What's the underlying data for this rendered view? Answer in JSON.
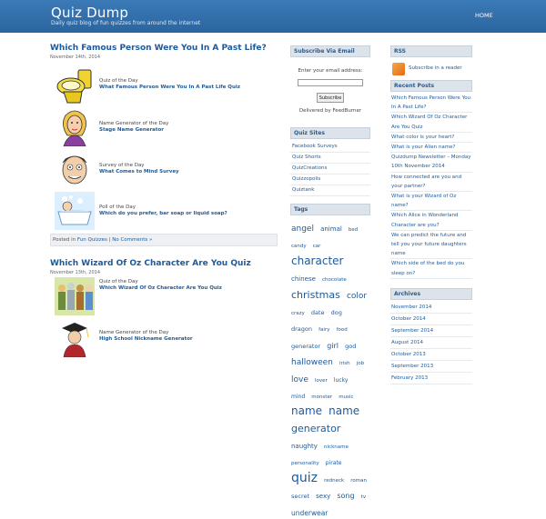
{
  "header": {
    "title": "Quiz Dump",
    "description": "Daily quiz blog of fun quizzes from around the internet",
    "nav_home": "HOME"
  },
  "posts": [
    {
      "title": "Which Famous Person Were You In A Past Life?",
      "date": "November 14th, 2014",
      "items": [
        {
          "category": "Quiz of the Day",
          "link": "What Famous Person Were You In A Past Life Quiz",
          "icon": "toilet-icon"
        },
        {
          "category": "Name Generator of the Day",
          "link": "Stage Name Generator",
          "icon": "woman-portrait-icon"
        },
        {
          "category": "Survey of the Day",
          "link": "What Comes to Mind Survey",
          "icon": "cartoon-face-icon"
        },
        {
          "category": "Poll of the Day",
          "link": "Which do you prefer, bar soap or liquid soap?",
          "icon": "bathtub-icon"
        }
      ],
      "meta_prefix": "Posted in",
      "meta_category": "Fun Quizzes",
      "meta_sep": "|",
      "meta_comments": "No Comments »"
    },
    {
      "title": "Which Wizard Of Oz Character Are You Quiz",
      "date": "November 13th, 2014",
      "items": [
        {
          "category": "Quiz of the Day",
          "link": "Which Wizard Of Oz Character Are You Quiz",
          "icon": "oz-characters-icon"
        },
        {
          "category": "Name Generator of the Day",
          "link": "High School Nickname Generator",
          "icon": "graduate-icon"
        }
      ]
    }
  ],
  "subscribe": {
    "title": "Subscribe Via Email",
    "label": "Enter your email address:",
    "input_value": "",
    "button": "Subscribe",
    "delivered": "Delivered by FeedBurner"
  },
  "quiz_sites": {
    "title": "Quiz Sites",
    "items": [
      "Facebook Surveys",
      "Quiz Shorts",
      "QuizCreations",
      "Quizzopolis",
      "Quiztank"
    ]
  },
  "tags_widget": {
    "title": "Tags",
    "tags": [
      {
        "t": "angel",
        "s": 9
      },
      {
        "t": "animal",
        "s": 7
      },
      {
        "t": "bed",
        "s": 5.5
      },
      {
        "t": "candy",
        "s": 5.5
      },
      {
        "t": "car",
        "s": 5.5
      },
      {
        "t": "character",
        "s": 12
      },
      {
        "t": "chinese",
        "s": 7
      },
      {
        "t": "chocolate",
        "s": 5.5
      },
      {
        "t": "christmas",
        "s": 11
      },
      {
        "t": "color",
        "s": 9
      },
      {
        "t": "crazy",
        "s": 5.5
      },
      {
        "t": "date",
        "s": 6.5
      },
      {
        "t": "dog",
        "s": 6.5
      },
      {
        "t": "dragon",
        "s": 6.5
      },
      {
        "t": "fairy",
        "s": 5.5
      },
      {
        "t": "food",
        "s": 5.5
      },
      {
        "t": "generator",
        "s": 6.5
      },
      {
        "t": "girl",
        "s": 8
      },
      {
        "t": "god",
        "s": 6.5
      },
      {
        "t": "halloween",
        "s": 9
      },
      {
        "t": "irish",
        "s": 5.5
      },
      {
        "t": "job",
        "s": 5.5
      },
      {
        "t": "love",
        "s": 9
      },
      {
        "t": "lover",
        "s": 5.5
      },
      {
        "t": "lucky",
        "s": 6
      },
      {
        "t": "mind",
        "s": 6
      },
      {
        "t": "monster",
        "s": 5.5
      },
      {
        "t": "music",
        "s": 5.5
      },
      {
        "t": "name",
        "s": 12
      },
      {
        "t": "name",
        "s": 12
      },
      {
        "t": "generator",
        "s": 11
      },
      {
        "t": "naughty",
        "s": 7
      },
      {
        "t": "nickname",
        "s": 5.5
      },
      {
        "t": "personality",
        "s": 5.5
      },
      {
        "t": "pirate",
        "s": 6
      },
      {
        "t": "quiz",
        "s": 14
      },
      {
        "t": "redneck",
        "s": 5.5
      },
      {
        "t": "roman",
        "s": 5.5
      },
      {
        "t": "secret",
        "s": 6.5
      },
      {
        "t": "sexy",
        "s": 7
      },
      {
        "t": "song",
        "s": 8
      },
      {
        "t": "tv",
        "s": 5.5
      },
      {
        "t": "underwear",
        "s": 7.5
      }
    ]
  },
  "rss": {
    "title": "RSS",
    "link": "Subscribe in a reader"
  },
  "recent_posts": {
    "title": "Recent Posts",
    "items": [
      "Which Famous Person Were You In A Past Life?",
      "Which Wizard Of Oz Character Are You Quiz",
      "What color is your heart?",
      "What is your Alien name?",
      "Quizdump Newsletter – Monday 10th November 2014",
      "How connected are you and your partner?",
      "What is your Wizard of Oz name?",
      "Which Alice in Wonderland Character are you?",
      "We can predict the future and tell you your future daughters name",
      "Which side of the bed do you sleep on?"
    ]
  },
  "archives": {
    "title": "Archives",
    "items": [
      "November 2014",
      "October 2014",
      "September 2014",
      "August 2014",
      "October 2013",
      "September 2013",
      "February 2013"
    ]
  }
}
